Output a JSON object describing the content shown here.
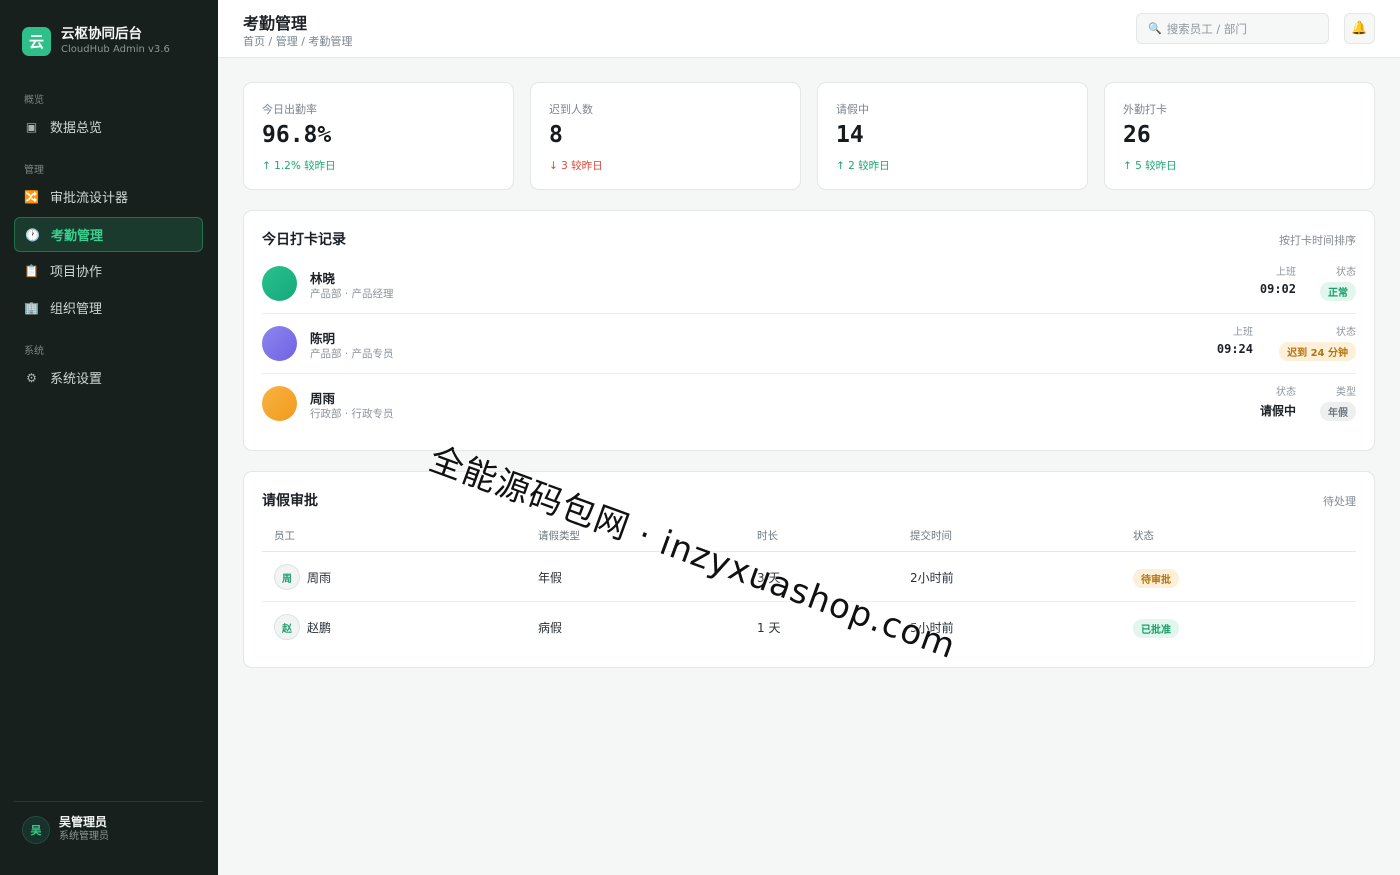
{
  "brand": {
    "logo": "云",
    "name": "云枢协同后台",
    "sub": "CloudHub Admin v3.6"
  },
  "nav": {
    "sections": [
      "概览",
      "管理",
      "系统"
    ],
    "items": [
      {
        "icon": "▣",
        "icon_name": "dashboard-icon",
        "label": "数据总览"
      },
      {
        "icon": "🔀",
        "icon_name": "workflow-icon",
        "label": "审批流设计器"
      },
      {
        "icon": "🕐",
        "icon_name": "clock-icon",
        "label": "考勤管理"
      },
      {
        "icon": "📋",
        "icon_name": "clipboard-icon",
        "label": "项目协作"
      },
      {
        "icon": "🏢",
        "icon_name": "building-icon",
        "label": "组织管理"
      },
      {
        "icon": "⚙",
        "icon_name": "gear-icon",
        "label": "系统设置"
      }
    ]
  },
  "user": {
    "initial": "吴",
    "name": "吴管理员",
    "role": "系统管理员"
  },
  "header": {
    "title": "考勤管理",
    "breadcrumb": "首页 / 管理 / 考勤管理",
    "search_placeholder": "搜索员工 / 部门",
    "search_icon": "🔍",
    "bell_icon": "🔔"
  },
  "stats": [
    {
      "label": "今日出勤率",
      "value": "96.8%",
      "delta": "↑ 1.2% 较昨日"
    },
    {
      "label": "迟到人数",
      "value": "8",
      "delta": "↓ 3 较昨日"
    },
    {
      "label": "请假中",
      "value": "14",
      "delta": "↑ 2 较昨日"
    },
    {
      "label": "外勤打卡",
      "value": "26",
      "delta": "↑ 5 较昨日"
    }
  ],
  "records": {
    "title": "今日打卡记录",
    "sort_label": "按打卡时间排序",
    "rows": [
      {
        "name": "林晓",
        "dept": "产品部 · 产品经理",
        "c1_label": "上班",
        "c1_value": "09:02",
        "c2_label": "状态",
        "c2_value": "正常"
      },
      {
        "name": "陈明",
        "dept": "产品部 · 产品专员",
        "c1_label": "上班",
        "c1_value": "09:24",
        "c2_label": "状态",
        "c2_value": "迟到 24 分钟"
      },
      {
        "name": "周雨",
        "dept": "行政部 · 行政专员",
        "c1_label": "状态",
        "c1_value": "请假中",
        "c2_label": "类型",
        "c2_value": "年假"
      }
    ]
  },
  "leave": {
    "title": "请假审批",
    "aside": "待处理",
    "columns": [
      "员工",
      "请假类型",
      "时长",
      "提交时间",
      "状态"
    ],
    "rows": [
      {
        "initial": "周",
        "name": "周雨",
        "type": "年假",
        "duration": "3 天",
        "submitted": "2小时前",
        "status": "待审批"
      },
      {
        "initial": "赵",
        "name": "赵鹏",
        "type": "病假",
        "duration": "1 天",
        "submitted": "5小时前",
        "status": "已批准"
      }
    ]
  },
  "watermark": "全能源码包网 · inzyxuashop.com"
}
